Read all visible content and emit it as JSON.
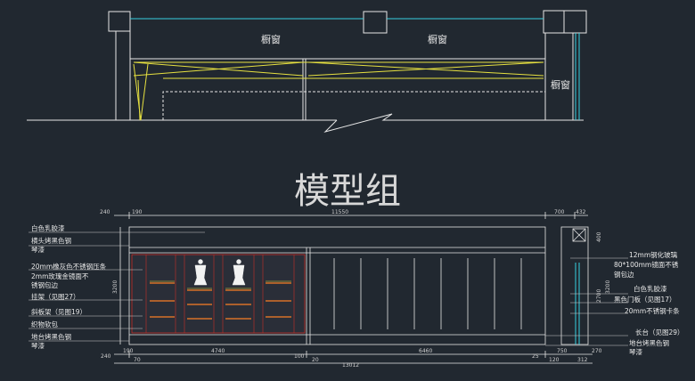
{
  "header": {
    "title": ""
  },
  "window_labels": [
    "橱窗",
    "橱窗",
    "橱窗"
  ],
  "watermark": "模型组",
  "dimensions": {
    "top": [
      "240",
      "190",
      "11550",
      "700",
      "432"
    ],
    "bottom": [
      "190",
      "240",
      "70",
      "4740",
      "100",
      "20",
      "6460",
      "25",
      "120",
      "750",
      "270",
      "312",
      "13012"
    ],
    "right_vertical": [
      "400",
      "3200",
      "2700"
    ],
    "left_vertical": [
      "3200"
    ]
  },
  "annotations_left": [
    "白色乳胶漆",
    "横头烤黑色钢",
    "琴漆",
    "20mm橡灰色不锈钢压条",
    "2mm玫瑰金镜面不",
    "锈钢包边",
    "挂架（见图27）",
    "斜板架（见图19）",
    "织物软包",
    "地台烤黑色钢",
    "琴漆"
  ],
  "annotations_right": [
    "12mm钢化玻璃",
    "80*100mm镜面不锈",
    "钢包边",
    "白色乳胶漆",
    "黑色门板（见图17）",
    "20mm不锈钢卡条",
    "长台（见图29）",
    "地台烤黑色钢",
    "琴漆"
  ],
  "colors": {
    "background": "#212830",
    "line_white": "#e6e6e6",
    "line_cyan": "#38d0e0",
    "line_yellow": "#e6e040",
    "line_orange": "#d87028",
    "line_red": "#c83028"
  }
}
